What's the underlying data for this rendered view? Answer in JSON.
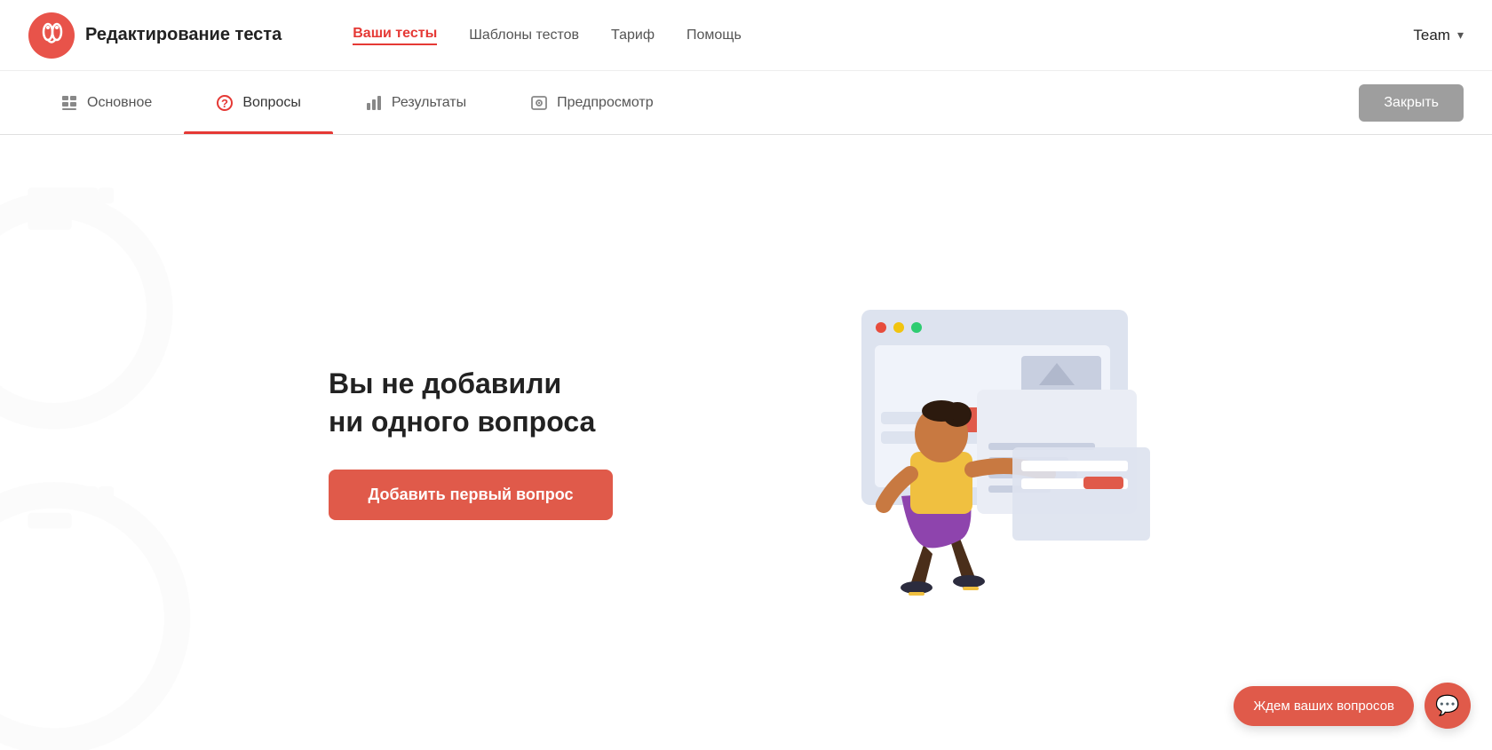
{
  "header": {
    "logo_text": "Редактирование теста",
    "nav": {
      "items": [
        {
          "label": "Ваши тесты",
          "active": true
        },
        {
          "label": "Шаблоны тестов",
          "active": false
        },
        {
          "label": "Тариф",
          "active": false
        },
        {
          "label": "Помощь",
          "active": false
        }
      ]
    },
    "team_label": "Team",
    "chevron": "▾"
  },
  "tabs": {
    "items": [
      {
        "label": "Основное",
        "active": false,
        "icon": "grid-icon"
      },
      {
        "label": "Вопросы",
        "active": true,
        "icon": "question-icon"
      },
      {
        "label": "Результаты",
        "active": false,
        "icon": "bar-icon"
      },
      {
        "label": "Предпросмотр",
        "active": false,
        "icon": "preview-icon"
      }
    ],
    "close_btn": "Закрыть"
  },
  "main": {
    "empty_title_line1": "Вы не добавили",
    "empty_title_line2": "ни одного вопроса",
    "add_btn": "Добавить первый вопрос"
  },
  "chat": {
    "label_btn": "Ждем ваших вопросов",
    "icon": "💬"
  },
  "colors": {
    "accent": "#e53935",
    "btn_red": "#e05a4a",
    "close_gray": "#9e9e9e"
  }
}
